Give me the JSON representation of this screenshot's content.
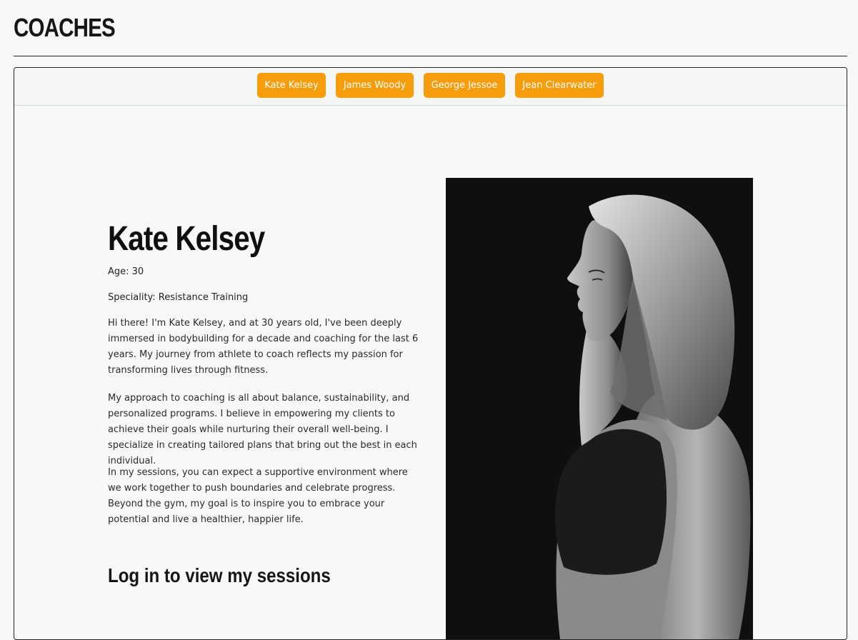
{
  "page": {
    "title": "COACHES"
  },
  "tabs": [
    {
      "label": "Kate Kelsey"
    },
    {
      "label": "James Woody"
    },
    {
      "label": "George Jessoe"
    },
    {
      "label": "Jean Clearwater"
    }
  ],
  "coach": {
    "name": "Kate Kelsey",
    "age_line": "Age: 30",
    "speciality_line": "Speciality: Resistance Training",
    "bio": [
      "Hi there! I'm Kate Kelsey, and at 30 years old, I've been deeply immersed in bodybuilding for a decade and coaching for the last 6 years. My journey from athlete to coach reflects my passion for transforming lives through fitness.",
      "My approach to coaching is all about balance, sustainability, and personalized programs. I believe in empowering my clients to achieve their goals while nurturing their overall well-being. I specialize in creating tailored plans that bring out the best in each individual.",
      "In my sessions, you can expect a supportive environment where we work together to push boundaries and celebrate progress. Beyond the gym, my goal is to inspire you to embrace your potential and live a healthier, happier life."
    ],
    "login_prompt": "Log in to view my sessions"
  },
  "colors": {
    "accent": "#f79d0c",
    "background": "#f7f9f7",
    "text": "#1e1e1e"
  }
}
